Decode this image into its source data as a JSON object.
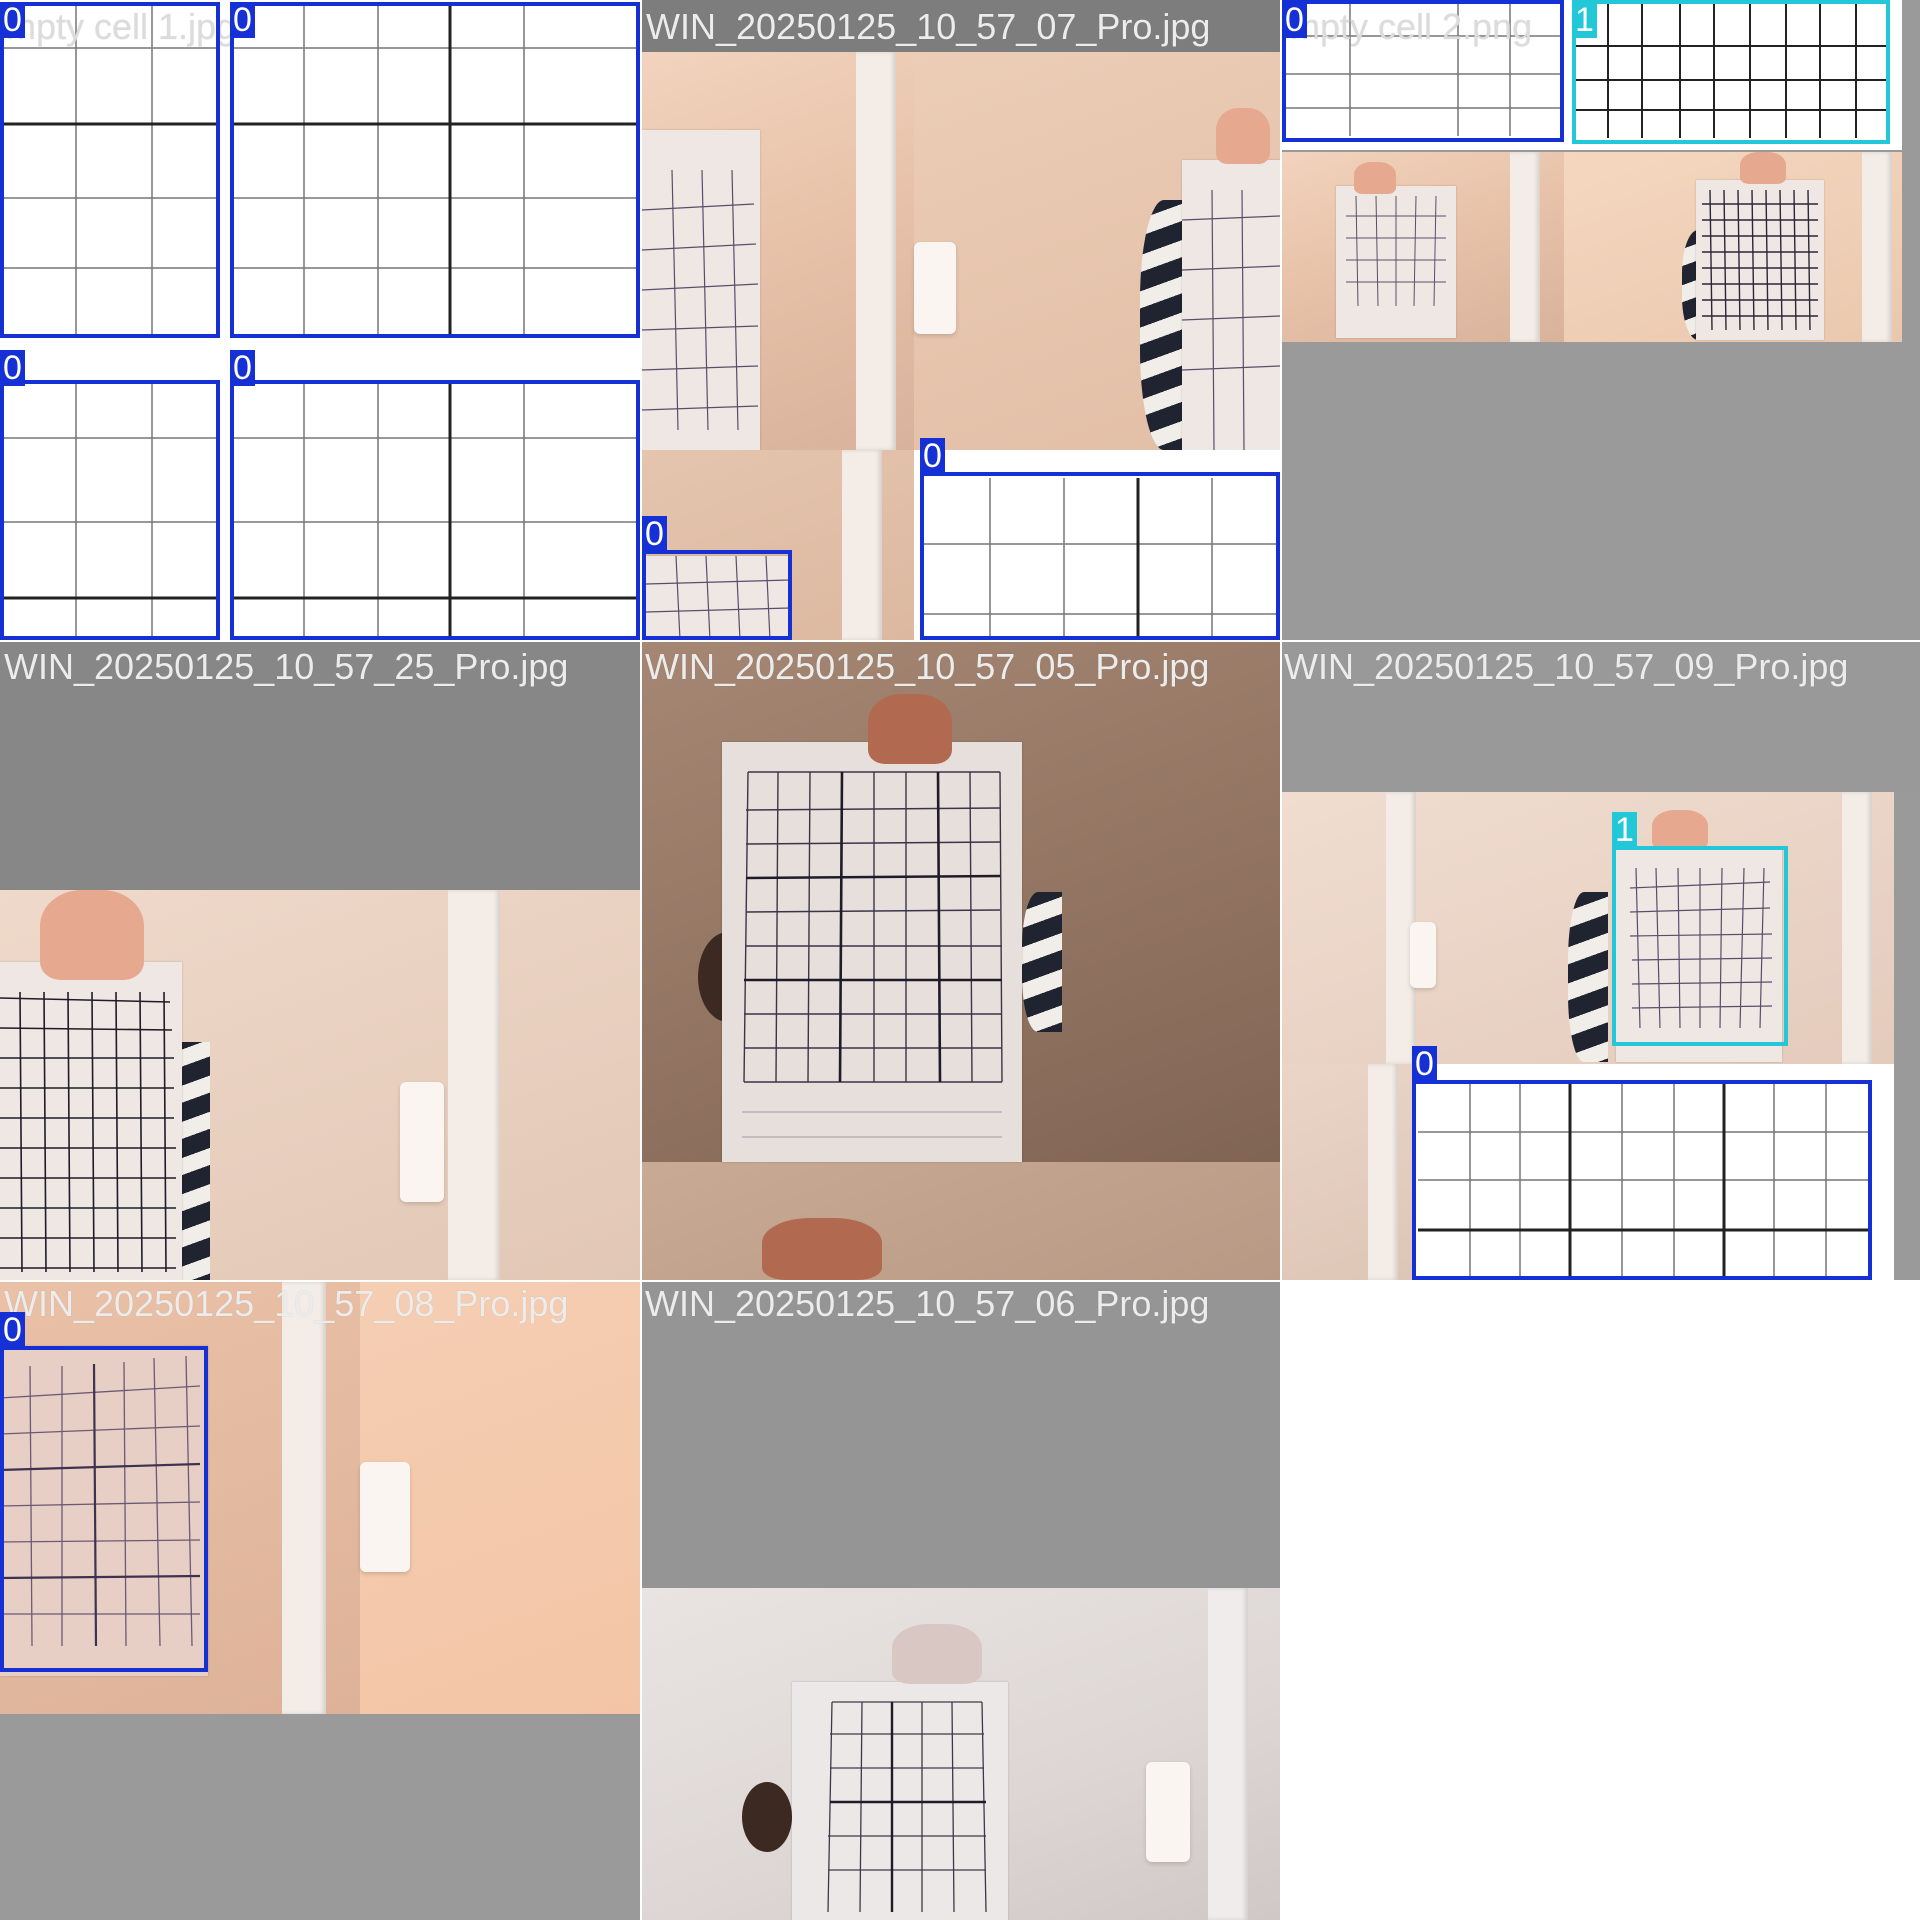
{
  "filenames": {
    "cell1": "mpty cell 1.jpg",
    "cell2": "WIN_20250125_10_57_07_Pro.jpg",
    "cell3": "mpty cell 2.png",
    "cell4": "WIN_20250125_10_57_25_Pro.jpg",
    "cell5": "WIN_20250125_10_57_05_Pro.jpg",
    "cell6": "WIN_20250125_10_57_09_Pro.jpg",
    "cell7": "WIN_20250125_10_57_08_Pro.jpg",
    "cell8": "WIN_20250125_10_57_06_Pro.jpg"
  },
  "labels": {
    "class0": "0",
    "class1": "1"
  },
  "colors": {
    "class0": "#1531d6",
    "class1": "#22c7d8",
    "letterbox": "#8f8f8f"
  }
}
